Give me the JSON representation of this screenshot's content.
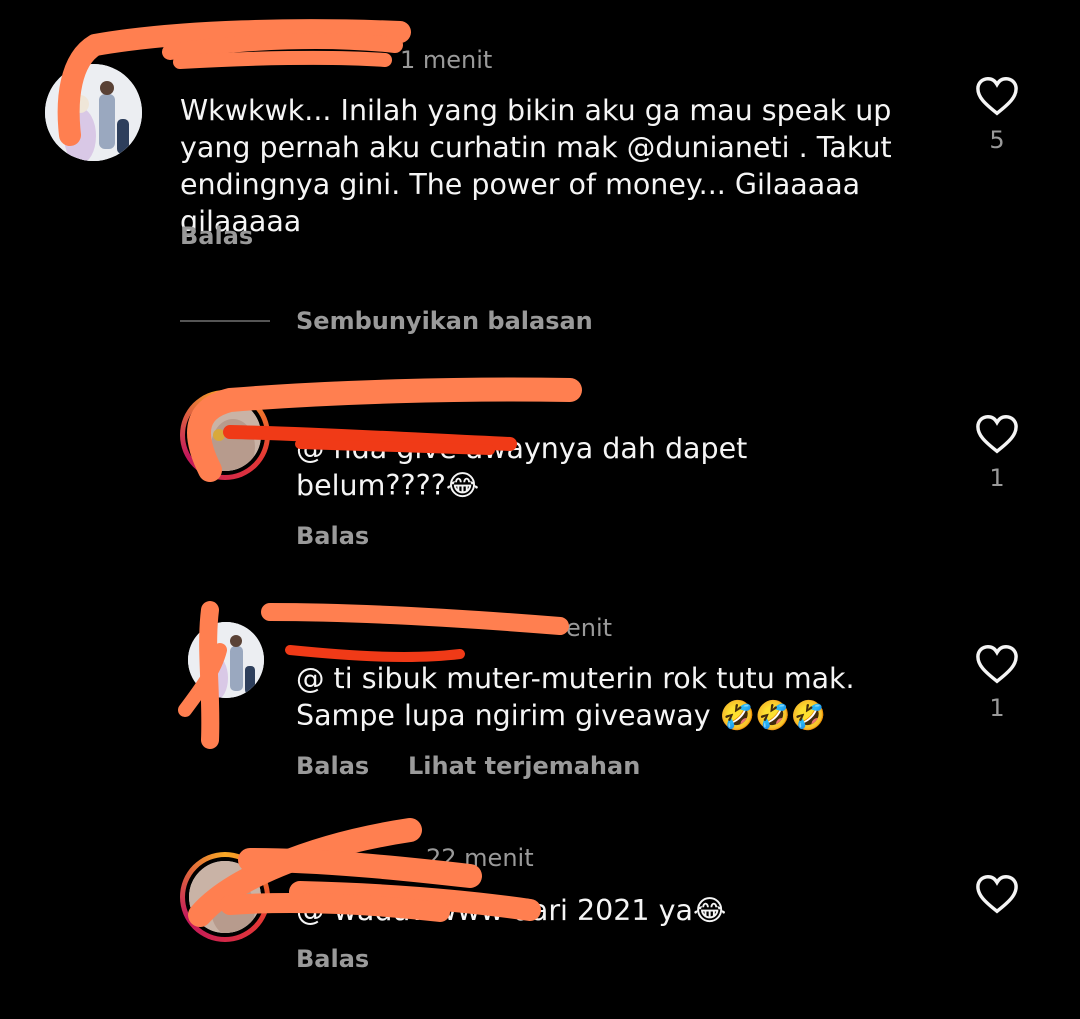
{
  "comments": [
    {
      "username": "",
      "time": "1 menit",
      "text": "Wkwkwk... Inilah yang bikin aku ga mau speak up yang pernah aku curhatin mak @dunianeti . Takut endingnya gini. The power of money... Gilaaaaa gilaaaaa",
      "reply_label": "Balas",
      "likes": "5"
    },
    {
      "username": "",
      "time": "",
      "text": "@ nda give awaynya dah dapet belum????😂",
      "reply_label": "Balas",
      "likes": "1"
    },
    {
      "username": "",
      "time": "enit",
      "text": "@ ti sibuk muter-muterin rok tutu mak. Sampe lupa ngirim giveaway 🤣🤣🤣",
      "reply_label": "Balas",
      "translate_label": "Lihat terjemahan",
      "likes": "1"
    },
    {
      "username": "",
      "time": "22 menit",
      "text": "@ waduwwww dari 2021 ya😂",
      "reply_label": "Balas",
      "likes": ""
    }
  ],
  "hide_replies_label": "Sembunyikan balasan",
  "colors": {
    "background": "#000000",
    "text": "#f5f5f5",
    "muted": "#9a9a9a",
    "scribble_orange": "#ff7f50",
    "scribble_red": "#f03a17"
  },
  "icons": [
    "heart-icon"
  ]
}
